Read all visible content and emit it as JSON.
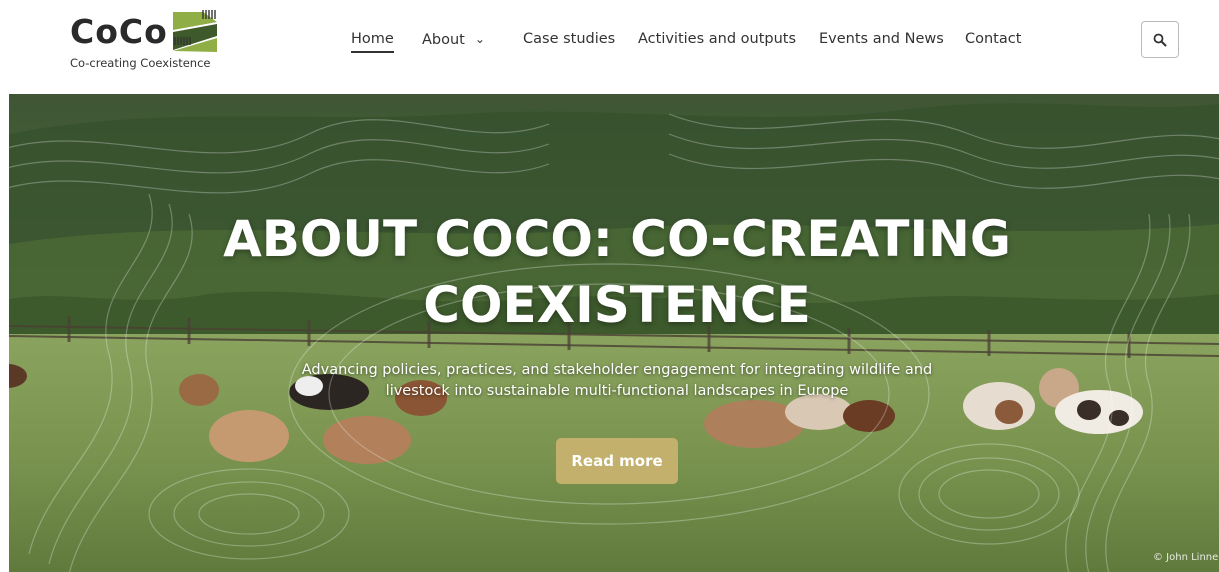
{
  "brand": {
    "name": "CoCo",
    "tagline": "Co-creating Coexistence",
    "logo_icon": "striped-field-logo-icon",
    "colors": {
      "dark_green": "#3f5a2a",
      "light_green": "#8fae46",
      "text": "#2a2a2a"
    }
  },
  "nav": {
    "items": [
      {
        "label": "Home",
        "active": true
      },
      {
        "label": "About",
        "has_dropdown": true
      },
      {
        "label": "Case studies"
      },
      {
        "label": "Activities and outputs"
      },
      {
        "label": "Events and News"
      },
      {
        "label": "Contact"
      }
    ],
    "search_icon": "search-icon"
  },
  "hero": {
    "title_line1": "ABOUT COCO: CO-CREATING",
    "title_line2": "COEXISTENCE",
    "subtitle_line1": "Advancing policies, practices, and stakeholder engagement for integrating wildlife and",
    "subtitle_line2": "livestock into sustainable multi-functional landscapes in Europe",
    "button_label": "Read more",
    "button_color": "#c2b06c",
    "credit": "© John Linnell"
  }
}
